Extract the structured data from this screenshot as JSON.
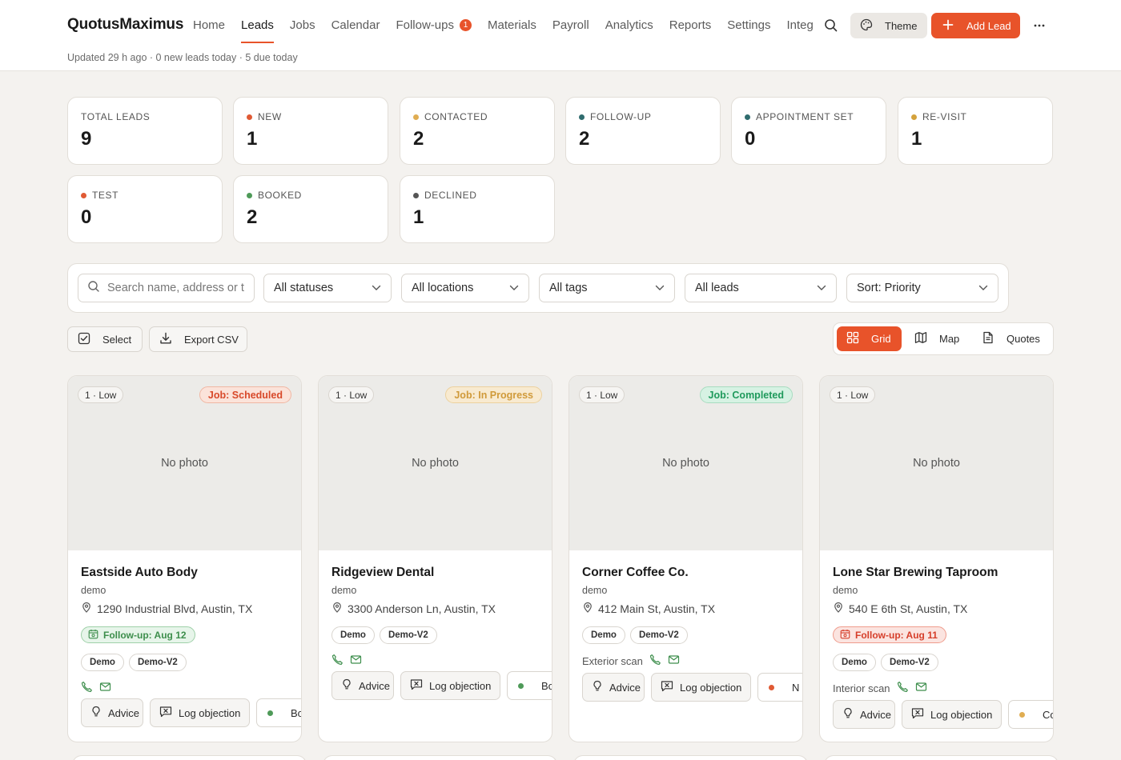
{
  "app": {
    "brand": "QuotusMaximus",
    "nav": [
      {
        "label": "Home",
        "active": false
      },
      {
        "label": "Leads",
        "active": true
      },
      {
        "label": "Jobs",
        "active": false
      },
      {
        "label": "Calendar",
        "active": false
      },
      {
        "label": "Follow-ups",
        "active": false,
        "badge": "1"
      },
      {
        "label": "Materials",
        "active": false
      },
      {
        "label": "Payroll",
        "active": false
      },
      {
        "label": "Analytics",
        "active": false
      },
      {
        "label": "Reports",
        "active": false
      },
      {
        "label": "Settings",
        "active": false
      },
      {
        "label": "Integ",
        "active": false
      }
    ],
    "theme_label": "Theme",
    "add_label": "Add Lead",
    "accent": "#e8532a"
  },
  "subline": "Updated 29 h ago · 0 new leads today · 5 due today",
  "stats": [
    {
      "label": "TOTAL LEADS",
      "value": "9",
      "color": null
    },
    {
      "label": "NEW",
      "value": "1",
      "color": "#e05a34"
    },
    {
      "label": "CONTACTED",
      "value": "2",
      "color": "#e0ad52"
    },
    {
      "label": "FOLLOW-UP",
      "value": "2",
      "color": "#2f6c6e"
    },
    {
      "label": "APPOINTMENT SET",
      "value": "0",
      "color": "#2f6c6e"
    },
    {
      "label": "RE-VISIT",
      "value": "1",
      "color": "#d4a23c"
    },
    {
      "label": "TEST",
      "value": "0",
      "color": "#e05a34"
    },
    {
      "label": "BOOKED",
      "value": "2",
      "color": "#4e9a58"
    },
    {
      "label": "DECLINED",
      "value": "1",
      "color": "#555555"
    }
  ],
  "filters": {
    "search_placeholder": "Search name, address or t",
    "status": "All statuses",
    "location": "All locations",
    "tags": "All tags",
    "leads": "All leads",
    "sort": "Sort: Priority"
  },
  "actions": {
    "select": "Select",
    "export": "Export CSV"
  },
  "views": {
    "grid": "Grid",
    "map": "Map",
    "quotes": "Quotes",
    "active": "grid"
  },
  "leads": [
    {
      "priority": "1 · Low",
      "job": "Job: Scheduled",
      "photo": "No photo",
      "name": "Eastside Auto Body",
      "source": "demo",
      "address": "1290 Industrial Blvd, Austin, TX",
      "follow_up": "Follow-up: Aug 12",
      "tags": [
        "Demo",
        "Demo-V2"
      ],
      "scan": "",
      "advice": "Advice",
      "log": "Log objection",
      "status": "Bo",
      "status_color": "#4e9a58"
    },
    {
      "priority": "1 · Low",
      "job": "Job: In Progress",
      "photo": "No photo",
      "name": "Ridgeview Dental",
      "source": "demo",
      "address": "3300 Anderson Ln, Austin, TX",
      "follow_up": "",
      "tags": [
        "Demo",
        "Demo-V2"
      ],
      "scan": "",
      "advice": "Advice",
      "log": "Log objection",
      "status": "Bo",
      "status_color": "#4e9a58"
    },
    {
      "priority": "1 · Low",
      "job": "Job: Completed",
      "photo": "No photo",
      "name": "Corner Coffee Co.",
      "source": "demo",
      "address": "412 Main St, Austin, TX",
      "follow_up": "",
      "tags": [
        "Demo",
        "Demo-V2"
      ],
      "scan": "Exterior scan",
      "advice": "Advice",
      "log": "Log objection",
      "status": "N",
      "status_color": "#e05a34"
    },
    {
      "priority": "1 · Low",
      "job": "",
      "photo": "No photo",
      "name": "Lone Star Brewing Taproom",
      "source": "demo",
      "address": "540 E 6th St, Austin, TX",
      "follow_up": "Follow-up: Aug 11",
      "tags": [
        "Demo",
        "Demo-V2"
      ],
      "scan": "Interior scan",
      "advice": "Advice",
      "log": "Log objection",
      "status": "Con",
      "status_color": "#e0ad52"
    }
  ]
}
